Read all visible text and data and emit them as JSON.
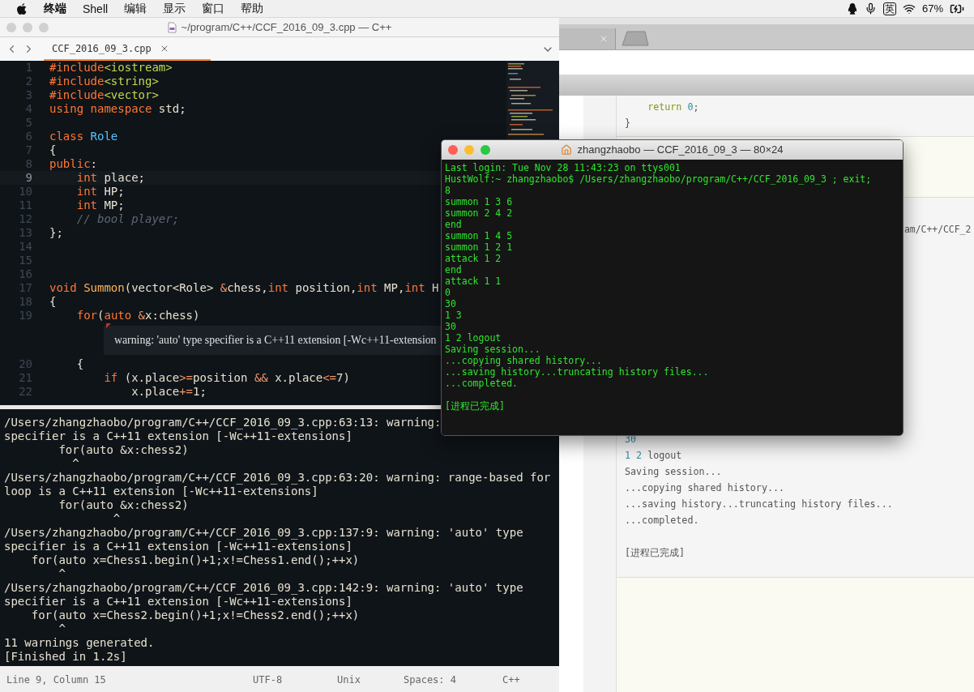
{
  "menu_bar": {
    "app_name": "终端",
    "menus": [
      "Shell",
      "编辑",
      "显示",
      "窗口",
      "帮助"
    ],
    "input_method": "英",
    "battery": "67%"
  },
  "editor": {
    "active": false,
    "title": "~/program/C++/CCF_2016_09_3.cpp — C++",
    "tab": {
      "label": "CCF_2016_09_3.cpp",
      "selected": true
    },
    "lines": [
      {
        "kind": "code",
        "number": "1",
        "current": false,
        "tokens": [
          {
            "text": "#include",
            "kind": "kw"
          },
          {
            "text": "<iostream>",
            "kind": "str"
          }
        ]
      },
      {
        "kind": "code",
        "number": "2",
        "current": false,
        "tokens": [
          {
            "text": "#include",
            "kind": "kw"
          },
          {
            "text": "<string>",
            "kind": "str"
          }
        ]
      },
      {
        "kind": "code",
        "number": "3",
        "current": false,
        "tokens": [
          {
            "text": "#include",
            "kind": "kw"
          },
          {
            "text": "<vector>",
            "kind": "str"
          }
        ]
      },
      {
        "kind": "code",
        "number": "4",
        "current": false,
        "tokens": [
          {
            "text": "using namespace",
            "kind": "kw"
          },
          {
            "text": " std;",
            "kind": "plain"
          }
        ]
      },
      {
        "kind": "code",
        "number": "5",
        "current": false
      },
      {
        "kind": "code",
        "number": "6",
        "current": false,
        "tokens": [
          {
            "text": "class",
            "kind": "kw"
          },
          {
            "text": " Role",
            "kind": "type"
          }
        ]
      },
      {
        "kind": "code",
        "number": "7",
        "current": false,
        "tokens": [
          {
            "text": "{",
            "kind": "plain"
          }
        ]
      },
      {
        "kind": "code",
        "number": "8",
        "current": false,
        "tokens": [
          {
            "text": "public",
            "kind": "kw"
          },
          {
            "text": ":",
            "kind": "plain"
          }
        ]
      },
      {
        "kind": "code",
        "number": "9",
        "current": true,
        "tokens": [
          {
            "text": "    int",
            "kind": "kw"
          },
          {
            "text": " place;",
            "kind": "plain"
          }
        ]
      },
      {
        "kind": "code",
        "number": "10",
        "current": false,
        "tokens": [
          {
            "text": "    int",
            "kind": "kw"
          },
          {
            "text": " HP;",
            "kind": "plain"
          }
        ]
      },
      {
        "kind": "code",
        "number": "11",
        "current": false,
        "tokens": [
          {
            "text": "    int",
            "kind": "kw"
          },
          {
            "text": " MP;",
            "kind": "plain"
          }
        ]
      },
      {
        "kind": "code",
        "number": "12",
        "current": false,
        "tokens": [
          {
            "text": "    // bool player;",
            "kind": "comment"
          }
        ]
      },
      {
        "kind": "code",
        "number": "13",
        "current": false,
        "tokens": [
          {
            "text": "};",
            "kind": "plain"
          }
        ]
      },
      {
        "kind": "code",
        "number": "14",
        "current": false
      },
      {
        "kind": "code",
        "number": "15",
        "current": false
      },
      {
        "kind": "code",
        "number": "16",
        "current": false
      },
      {
        "kind": "code",
        "number": "17",
        "current": false,
        "tokens": [
          {
            "text": "void",
            "kind": "kw"
          },
          {
            "text": " Summon",
            "kind": "fn"
          },
          {
            "text": "(vector<Role> ",
            "kind": "plain"
          },
          {
            "text": "&",
            "kind": "op"
          },
          {
            "text": "chess,",
            "kind": "plain"
          },
          {
            "text": "int",
            "kind": "kw"
          },
          {
            "text": " position,",
            "kind": "plain"
          },
          {
            "text": "int",
            "kind": "kw"
          },
          {
            "text": " MP,",
            "kind": "plain"
          },
          {
            "text": "int",
            "kind": "kw"
          },
          {
            "text": " H",
            "kind": "plain"
          }
        ]
      },
      {
        "kind": "code",
        "number": "18",
        "current": false,
        "tokens": [
          {
            "text": "{",
            "kind": "plain"
          }
        ]
      },
      {
        "kind": "code",
        "number": "19",
        "current": false,
        "tokens": [
          {
            "text": "    for",
            "kind": "kw"
          },
          {
            "text": "(",
            "kind": "plain"
          },
          {
            "text": "auto",
            "kind": "kw"
          },
          {
            "text": " &",
            "kind": "op"
          },
          {
            "text": "x:chess)",
            "kind": "plain"
          }
        ]
      },
      {
        "kind": "phantom",
        "text": "warning: 'auto' type specifier is a C++11 extension [-Wc++11-extension"
      },
      {
        "kind": "code",
        "number": "20",
        "current": false,
        "tokens": [
          {
            "text": "    {",
            "kind": "plain"
          }
        ]
      },
      {
        "kind": "code",
        "number": "21",
        "current": false,
        "tokens": [
          {
            "text": "        if",
            "kind": "kw"
          },
          {
            "text": " (x.place",
            "kind": "plain"
          },
          {
            "text": ">=",
            "kind": "op"
          },
          {
            "text": "position ",
            "kind": "plain"
          },
          {
            "text": "&&",
            "kind": "op"
          },
          {
            "text": " x.place",
            "kind": "plain"
          },
          {
            "text": "<=",
            "kind": "op"
          },
          {
            "text": "7)",
            "kind": "plain"
          }
        ]
      },
      {
        "kind": "code",
        "number": "22",
        "current": false,
        "tokens": [
          {
            "text": "            x.place",
            "kind": "plain"
          },
          {
            "text": "+=",
            "kind": "op"
          },
          {
            "text": "1;",
            "kind": "plain"
          }
        ]
      }
    ],
    "build_output": [
      "/Users/zhangzhaobo/program/C++/CCF_2016_09_3.cpp:63:13: warning:",
      "specifier is a C++11 extension [-Wc++11-extensions]",
      "        for(auto &x:chess2)",
      "          ^",
      "/Users/zhangzhaobo/program/C++/CCF_2016_09_3.cpp:63:20: warning: range-based for",
      "loop is a C++11 extension [-Wc++11-extensions]",
      "        for(auto &x:chess2)",
      "                ^",
      "/Users/zhangzhaobo/program/C++/CCF_2016_09_3.cpp:137:9: warning: 'auto' type",
      "specifier is a C++11 extension [-Wc++11-extensions]",
      "    for(auto x=Chess1.begin()+1;x!=Chess1.end();++x)",
      "        ^",
      "/Users/zhangzhaobo/program/C++/CCF_2016_09_3.cpp:142:9: warning: 'auto' type",
      "specifier is a C++11 extension [-Wc++11-extensions]",
      "    for(auto x=Chess2.begin()+1;x!=Chess2.end();++x)",
      "        ^",
      "11 warnings generated.",
      "[Finished in 1.2s]"
    ],
    "status_bar": {
      "position": "Line 9, Column 15",
      "encoding": "UTF-8",
      "line_endings": "Unix",
      "indentation": "Spaces: 4",
      "syntax": "C++"
    }
  },
  "background_window": {
    "code_lines": [
      [
        {
          "text": "    return",
          "kind": "kw"
        },
        {
          "text": " 0",
          "kind": "num"
        },
        {
          "text": ";",
          "kind": "text"
        }
      ],
      [
        {
          "text": "}",
          "kind": "text"
        }
      ]
    ],
    "output_fragment": "am/C++/CCF_2",
    "output_lines": [
      [
        {
          "text": "30",
          "kind": "num"
        }
      ],
      [
        {
          "text": "1 2",
          "kind": "num"
        },
        {
          "text": " logout",
          "kind": "text"
        }
      ],
      [
        {
          "text": "Saving session...",
          "kind": "text"
        }
      ],
      [
        {
          "text": "...copying shared history...",
          "kind": "text"
        }
      ],
      [
        {
          "text": "...saving history...truncating history files...",
          "kind": "text"
        }
      ],
      [
        {
          "text": "...completed.",
          "kind": "text"
        }
      ]
    ],
    "process_status": "[进程已完成]"
  },
  "terminal": {
    "active": true,
    "title": "zhangzhaobo — CCF_2016_09_3 — 80×24",
    "lines": [
      "Last login: Tue Nov 28 11:43:23 on ttys001",
      "HustWolf:~ zhangzhaobo$ /Users/zhangzhaobo/program/C++/CCF_2016_09_3 ; exit;",
      "8",
      "summon 1 3 6",
      "summon 2 4 2",
      "end",
      "summon 1 4 5",
      "summon 1 2 1",
      "attack 1 2",
      "end",
      "attack 1 1",
      "0",
      "30",
      "1 3",
      "30",
      "1 2 logout",
      "Saving session...",
      "...copying shared history...",
      "...saving history...truncating history files...",
      "...completed."
    ],
    "process_status": "[进程已完成]"
  }
}
